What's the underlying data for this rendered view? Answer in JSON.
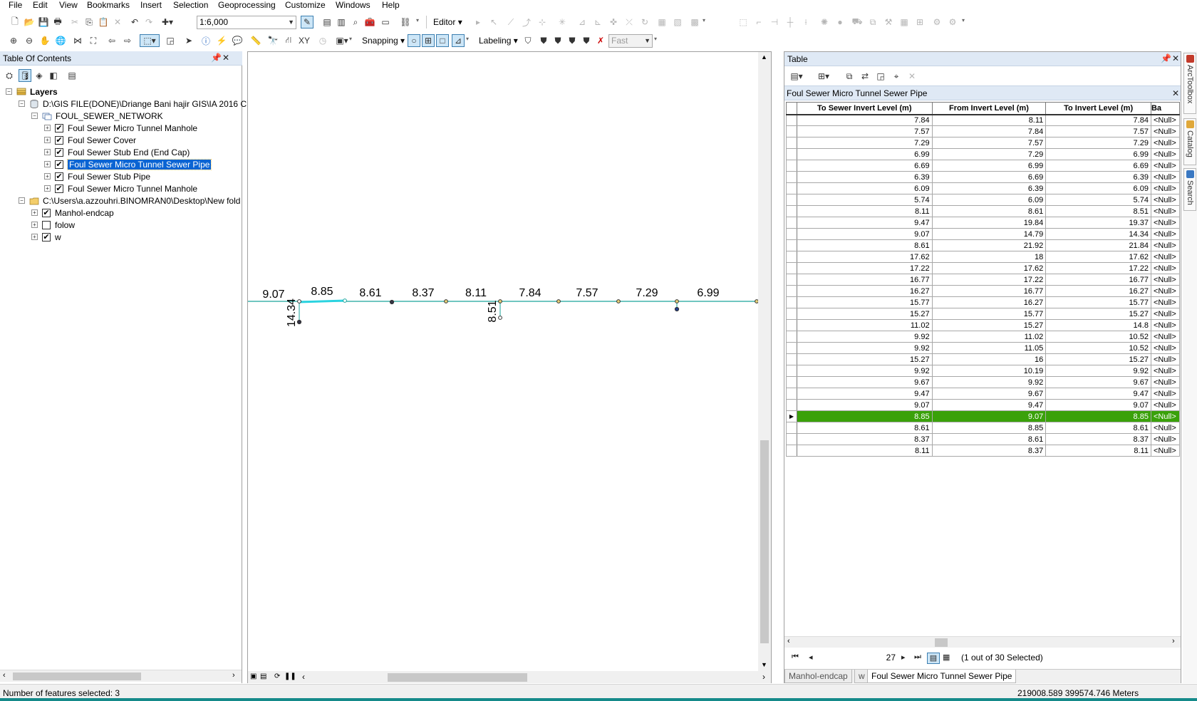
{
  "menu": [
    "File",
    "Edit",
    "View",
    "Bookmarks",
    "Insert",
    "Selection",
    "Geoprocessing",
    "Customize",
    "Windows",
    "Help"
  ],
  "toolbar": {
    "scale": "1:6,000",
    "editor_label": "Editor",
    "snapping_label": "Snapping",
    "labeling_label": "Labeling",
    "fast_label": "Fast"
  },
  "toc": {
    "title": "Table Of Contents",
    "root_label": "Layers",
    "items": [
      {
        "label": "D:\\GIS FILE(DONE)\\Driange Bani hajir GIS\\IA 2016 C (",
        "kind": "database"
      },
      {
        "label": "FOUL_SEWER_NETWORK",
        "kind": "dataset"
      },
      {
        "label": "Foul Sewer Micro Tunnel Manhole",
        "checked": true
      },
      {
        "label": "Foul Sewer Cover",
        "checked": true
      },
      {
        "label": "Foul Sewer Stub End (End Cap)",
        "checked": true
      },
      {
        "label": "Foul Sewer Micro Tunnel Sewer Pipe",
        "checked": true,
        "selected": true
      },
      {
        "label": "Foul Sewer Stub Pipe",
        "checked": true
      },
      {
        "label": "Foul Sewer Micro Tunnel Manhole",
        "checked": true
      },
      {
        "label": "C:\\Users\\a.azzouhri.BINOMRAN0\\Desktop\\New fold",
        "kind": "folder"
      },
      {
        "label": "Manhol-endcap",
        "checked": true
      },
      {
        "label": "folow",
        "checked": false
      },
      {
        "label": "w",
        "checked": true
      }
    ]
  },
  "map": {
    "labels": [
      "9.07",
      "8.85",
      "8.61",
      "8.37",
      "8.11",
      "7.84",
      "7.57",
      "7.29",
      "6.99"
    ],
    "vertical_labels": [
      "14.34",
      "8.51"
    ],
    "line_color": "#1aa39a",
    "selected_color": "#2bd3e0"
  },
  "table_window": {
    "title": "Table",
    "table_name": "Foul Sewer Micro Tunnel Sewer Pipe",
    "columns": [
      "To Sewer Invert Level (m)",
      "From Invert Level (m)",
      "To Invert Level (m)",
      "Ba"
    ],
    "rows": [
      [
        "7.84",
        "8.11",
        "7.84",
        "<Null>"
      ],
      [
        "7.57",
        "7.84",
        "7.57",
        "<Null>"
      ],
      [
        "7.29",
        "7.57",
        "7.29",
        "<Null>"
      ],
      [
        "6.99",
        "7.29",
        "6.99",
        "<Null>"
      ],
      [
        "6.69",
        "6.99",
        "6.69",
        "<Null>"
      ],
      [
        "6.39",
        "6.69",
        "6.39",
        "<Null>"
      ],
      [
        "6.09",
        "6.39",
        "6.09",
        "<Null>"
      ],
      [
        "5.74",
        "6.09",
        "5.74",
        "<Null>"
      ],
      [
        "8.11",
        "8.61",
        "8.51",
        "<Null>"
      ],
      [
        "9.47",
        "19.84",
        "19.37",
        "<Null>"
      ],
      [
        "9.07",
        "14.79",
        "14.34",
        "<Null>"
      ],
      [
        "8.61",
        "21.92",
        "21.84",
        "<Null>"
      ],
      [
        "17.62",
        "18",
        "17.62",
        "<Null>"
      ],
      [
        "17.22",
        "17.62",
        "17.22",
        "<Null>"
      ],
      [
        "16.77",
        "17.22",
        "16.77",
        "<Null>"
      ],
      [
        "16.27",
        "16.77",
        "16.27",
        "<Null>"
      ],
      [
        "15.77",
        "16.27",
        "15.77",
        "<Null>"
      ],
      [
        "15.27",
        "15.77",
        "15.27",
        "<Null>"
      ],
      [
        "11.02",
        "15.27",
        "14.8",
        "<Null>"
      ],
      [
        "9.92",
        "11.02",
        "10.52",
        "<Null>"
      ],
      [
        "9.92",
        "11.05",
        "10.52",
        "<Null>"
      ],
      [
        "15.27",
        "16",
        "15.27",
        "<Null>"
      ],
      [
        "9.92",
        "10.19",
        "9.92",
        "<Null>"
      ],
      [
        "9.67",
        "9.92",
        "9.67",
        "<Null>"
      ],
      [
        "9.47",
        "9.67",
        "9.47",
        "<Null>"
      ],
      [
        "9.07",
        "9.47",
        "9.07",
        "<Null>"
      ],
      [
        "8.85",
        "9.07",
        "8.85",
        "<Null>"
      ],
      [
        "8.61",
        "8.85",
        "8.61",
        "<Null>"
      ],
      [
        "8.37",
        "8.61",
        "8.37",
        "<Null>"
      ],
      [
        "8.11",
        "8.37",
        "8.11",
        "<Null>"
      ]
    ],
    "highlight_row": 26,
    "highlight_color": "#3aa10a",
    "current_record": "27",
    "selection_info": "(1 out of 30 Selected)",
    "tabs": [
      "Manhol-endcap",
      "w",
      "Foul Sewer Micro Tunnel Sewer Pipe"
    ]
  },
  "right_dock": [
    "ArcToolbox",
    "Catalog",
    "Search"
  ],
  "status": {
    "features_selected": "Number of features selected: 3",
    "coordinates": "219008.589  399574.746 Meters"
  }
}
